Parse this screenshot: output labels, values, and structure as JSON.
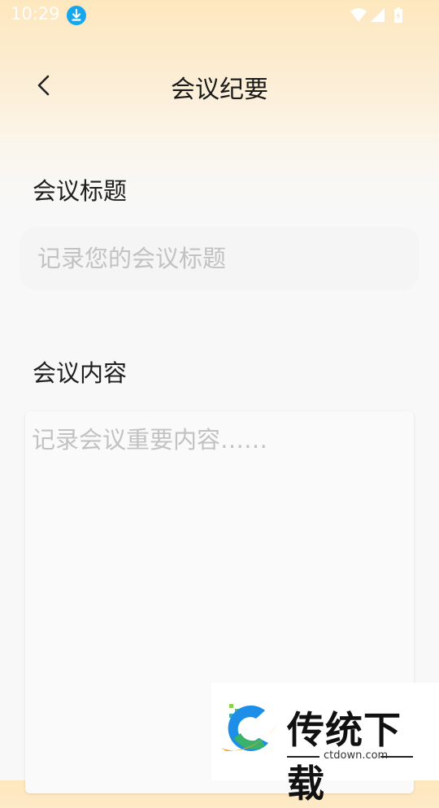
{
  "status_bar": {
    "time": "10:29",
    "icons": [
      "download-badge-icon",
      "wifi-icon",
      "signal-icon",
      "battery-icon"
    ]
  },
  "header": {
    "title": "会议纪要",
    "back_icon": "chevron-left-icon"
  },
  "form": {
    "title_label": "会议标题",
    "title_placeholder": "记录您的会议标题",
    "content_label": "会议内容",
    "content_placeholder": "记录会议重要内容……"
  },
  "watermark": {
    "logo_text": "传统下载",
    "url": "ctdown.com"
  },
  "colors": {
    "header_gradient_top": "#fde7be",
    "background": "#f8f8f8",
    "placeholder": "#c2c2c2",
    "download_badge": "#16a6ee"
  }
}
